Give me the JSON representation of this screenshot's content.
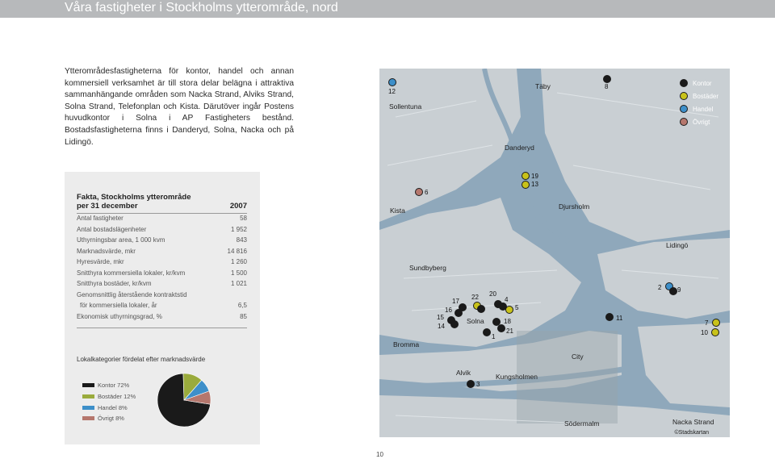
{
  "page": {
    "title": "Våra fastigheter i Stockholms ytterområde, nord",
    "intro": "Ytterområdesfastigheterna för kontor, handel och annan kommersiell verksamhet är till stora delar belägna i attraktiva sammanhängande områden som Nacka Strand, Alviks Strand, Solna Strand, Telefonplan och Kista. Därutöver ingår Postens huvudkontor i Solna i AP Fastigheters bestånd. Bostadsfastigheterna finns i Danderyd, Solna, Nacka och på Lidingö.",
    "page_number": "10"
  },
  "facts": {
    "heading_line1": "Fakta, Stockholms ytterområde",
    "heading_line2": "per 31 december",
    "year": "2007",
    "rows": [
      {
        "label": "Antal fastigheter",
        "value": "58"
      },
      {
        "label": "Antal bostadslägenheter",
        "value": "1 952"
      },
      {
        "label": "Uthyrningsbar area, 1 000 kvm",
        "value": "843"
      },
      {
        "label": "Marknadsvärde, mkr",
        "value": "14 816"
      },
      {
        "label": "Hyresvärde, mkr",
        "value": "1 260"
      },
      {
        "label": "Snitthyra kommersiella lokaler, kr/kvm",
        "value": "1 500"
      },
      {
        "label": "Snitthyra bostäder, kr/kvm",
        "value": "1 021"
      },
      {
        "label": "Genomsnittlig återstående kontraktstid",
        "value": ""
      },
      {
        "label": "för kommersiella lokaler, år",
        "value": "6,5"
      },
      {
        "label": "Ekonomisk uthyrningsgrad, %",
        "value": "85"
      }
    ]
  },
  "category_chart": {
    "title": "Lokalkategorier fördelat efter marknadsvärde",
    "legend": [
      {
        "label": "Kontor 72%",
        "color": "#1a1a1a"
      },
      {
        "label": "Bostäder 12%",
        "color": "#9aab3c"
      },
      {
        "label": "Handel 8%",
        "color": "#3d8fc9"
      },
      {
        "label": "Övrigt 8%",
        "color": "#b5776d"
      }
    ]
  },
  "chart_data": {
    "type": "pie",
    "categories": [
      "Kontor",
      "Bostäder",
      "Handel",
      "Övrigt"
    ],
    "values": [
      72,
      12,
      8,
      8
    ],
    "colors": [
      "#1a1a1a",
      "#9aab3c",
      "#3d8fc9",
      "#b5776d"
    ],
    "title": "Lokalkategorier fördelat efter marknadsvärde"
  },
  "map": {
    "legend": [
      {
        "label": "Kontor",
        "color": "#1a1a1a"
      },
      {
        "label": "Bostäder",
        "color": "#c8c21a"
      },
      {
        "label": "Handel",
        "color": "#3d8fc9"
      },
      {
        "label": "Övrigt",
        "color": "#b5776d"
      }
    ],
    "places": {
      "sollentuna": "Sollentuna",
      "taby": "Täby",
      "danderyd": "Danderyd",
      "kista": "Kista",
      "djursholm": "Djursholm",
      "lidingo": "Lidingö",
      "sundbyberg": "Sundbyberg",
      "solna": "Solna",
      "bromma": "Bromma",
      "city": "City",
      "alvik": "Alvik",
      "kungsholmen": "Kungsholmen",
      "sodermalm": "Södermalm",
      "nacka_strand": "Nacka Strand"
    },
    "credit": "©Stadskartan",
    "markers": {
      "m12": "12",
      "m8": "8",
      "m19": "19",
      "m13": "13",
      "m6": "6",
      "m2": "2",
      "m9": "9",
      "m17": "17",
      "m22": "22",
      "m20": "20",
      "m4": "4",
      "m5": "5",
      "m16": "16",
      "m15": "15",
      "m14": "14",
      "m18": "18",
      "m1": "1",
      "m21": "21",
      "m11": "11",
      "m7": "7",
      "m10": "10",
      "m3": "3"
    }
  }
}
